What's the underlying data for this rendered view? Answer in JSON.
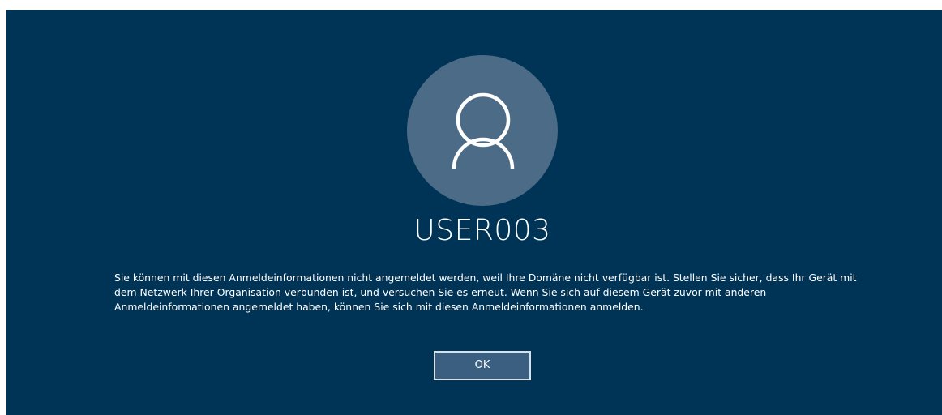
{
  "login": {
    "username": "USER003",
    "avatar_icon": "user-icon",
    "message": "Sie können mit diesen Anmeldeinformationen nicht angemeldet werden, weil Ihre Domäne nicht verfügbar ist. Stellen Sie sicher, dass Ihr Gerät mit dem Netzwerk Ihrer Organisation verbunden ist, und versuchen Sie es erneut. Wenn Sie sich auf diesem Gerät zuvor mit anderen Anmeldeinformationen angemeldet haben, können Sie sich mit diesen Anmeldeinformationen anmelden.",
    "ok_label": "OK"
  },
  "colors": {
    "background": "#003457",
    "avatar_circle": "#4c6b86",
    "button_fill": "#3a5f80",
    "button_border": "#d9e1e8",
    "text": "#ffffff"
  }
}
